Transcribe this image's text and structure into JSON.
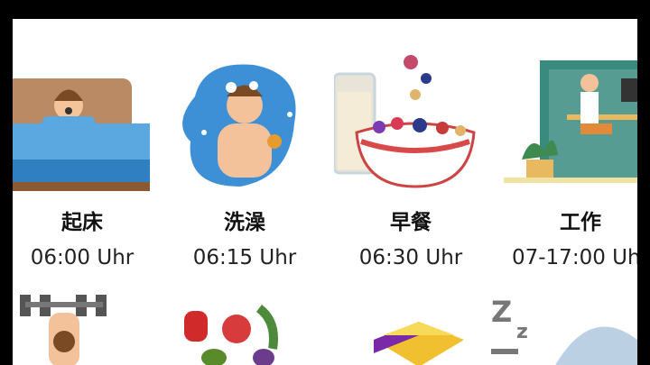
{
  "schedule": [
    {
      "icon": "waking-up-icon",
      "label": "起床",
      "time": "06:00 Uhr"
    },
    {
      "icon": "shower-icon",
      "label": "洗澡",
      "time": "06:15 Uhr"
    },
    {
      "icon": "breakfast-icon",
      "label": "早餐",
      "time": "06:30 Uhr"
    },
    {
      "icon": "work-desk-icon",
      "label": "工作",
      "time": "07-17:00 Uhr"
    }
  ],
  "row2_icons": [
    "dumbbell-exercise-icon",
    "vegetables-icon",
    "books-icon",
    "sleep-icon"
  ]
}
